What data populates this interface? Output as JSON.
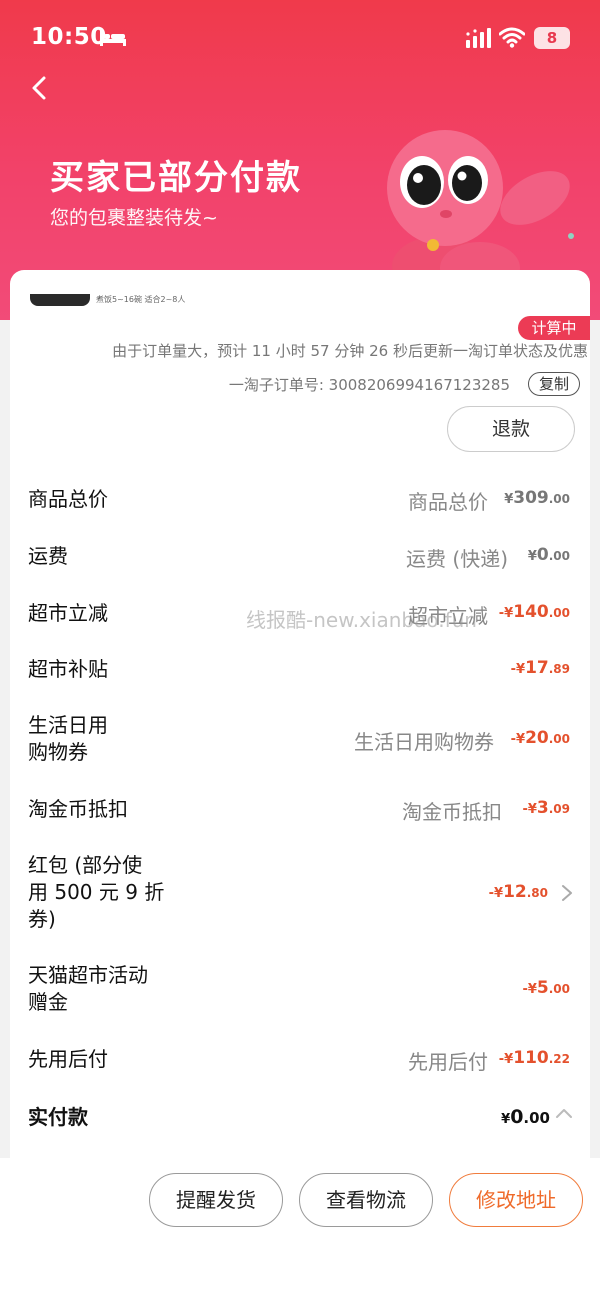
{
  "status_bar": {
    "time": "10:50",
    "battery": "8"
  },
  "header": {
    "title": "买家已部分付款",
    "subtitle": "您的包裹整装待发~"
  },
  "order": {
    "thumb_caption": "煮饭5~16碗 适合2~8人",
    "calc_badge": "计算中",
    "update_notice": "由于订单量大，预计 11 小时 57 分钟 26 秒后更新一淘订单状态及优惠",
    "sub_order_number": "一淘子订单号: 3008206994167123285",
    "copy_label": "复制",
    "refund_label": "退款"
  },
  "price_rows": [
    {
      "label": "商品总价",
      "desc": "商品总价",
      "sym": "¥",
      "int": "309",
      "dec": ".00",
      "tone": "gray"
    },
    {
      "label": "运费",
      "desc": "运费 (快递)",
      "sym": "¥",
      "int": "0",
      "dec": ".00",
      "tone": "gray"
    },
    {
      "label": "超市立减",
      "desc": "超市立减",
      "sym": "-¥",
      "int": "140",
      "dec": ".00",
      "tone": "red"
    },
    {
      "label": "超市补贴",
      "desc": "",
      "sym": "-¥",
      "int": "17",
      "dec": ".89",
      "tone": "red"
    },
    {
      "label": "生活日用\n购物券",
      "desc": "生活日用购物券",
      "sym": "-¥",
      "int": "20",
      "dec": ".00",
      "tone": "red"
    },
    {
      "label": "淘金币抵扣",
      "desc": "淘金币抵扣",
      "sym": "-¥",
      "int": "3",
      "dec": ".09",
      "tone": "red"
    },
    {
      "label": "红包 (部分使\n用 500 元 9 折\n券)",
      "desc": "",
      "sym": "-¥",
      "int": "12",
      "dec": ".80",
      "tone": "red"
    },
    {
      "label": "天猫超市活动\n赠金",
      "desc": "",
      "sym": "-¥",
      "int": "5",
      "dec": ".00",
      "tone": "red"
    },
    {
      "label": "先用后付",
      "desc": "先用后付",
      "sym": "-¥",
      "int": "110",
      "dec": ".22",
      "tone": "red"
    }
  ],
  "total": {
    "label": "实付款",
    "sym": "¥",
    "int": "0",
    "dec": ".00"
  },
  "watermark": "线报酷-new.xianbao.fun",
  "actions": {
    "remind": "提醒发货",
    "logistics": "查看物流",
    "address": "修改地址"
  },
  "colors": {
    "header_red": "#f03a4b",
    "price_red": "#e4512d",
    "accent_orange": "#ef6a2a"
  }
}
